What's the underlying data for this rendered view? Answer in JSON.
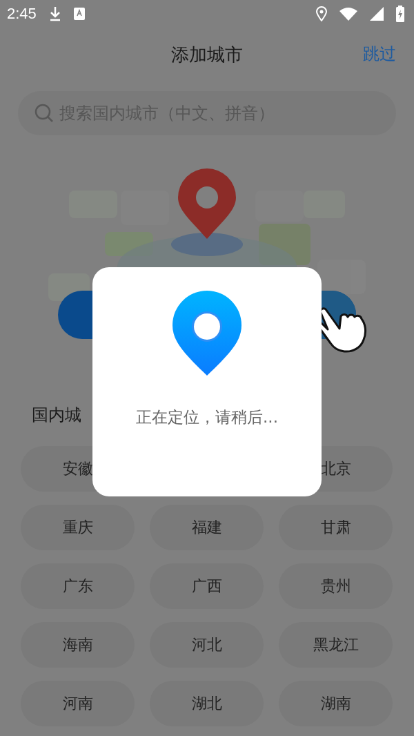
{
  "status_bar": {
    "time": "2:45"
  },
  "header": {
    "title": "添加城市",
    "skip": "跳过"
  },
  "search": {
    "placeholder": "搜索国内城市（中文、拼音）"
  },
  "section_title": "国内城",
  "city_rows": [
    {
      "left": "安徽",
      "right": "北京"
    },
    {
      "left": "重庆",
      "middle": "福建",
      "right": "甘肃"
    },
    {
      "left": "广东",
      "middle": "广西",
      "right": "贵州"
    },
    {
      "left": "海南",
      "middle": "河北",
      "right": "黑龙江"
    },
    {
      "left": "河南",
      "middle": "湖北",
      "right": "湖南"
    }
  ],
  "dialog": {
    "message": "正在定位，请稍后..."
  }
}
